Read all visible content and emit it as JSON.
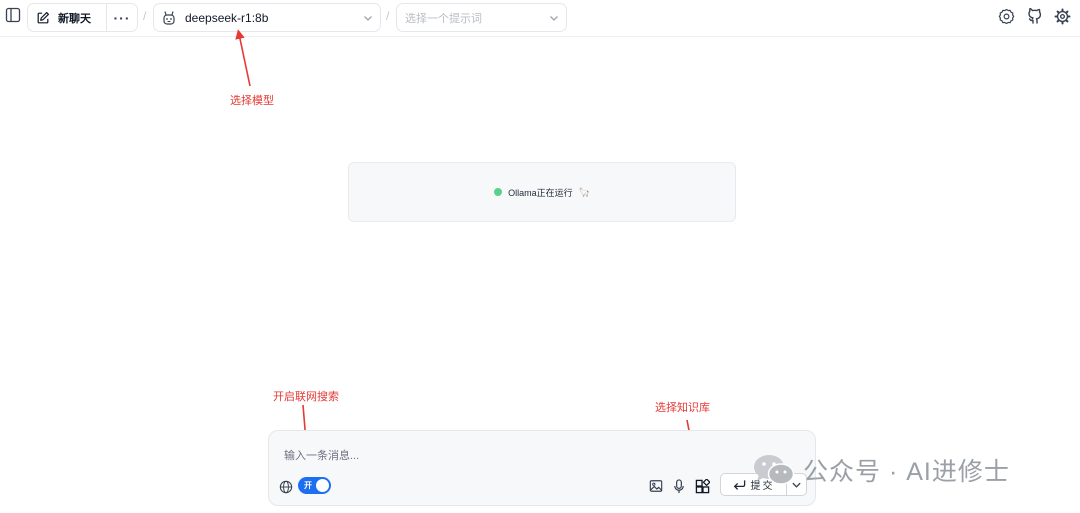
{
  "topbar": {
    "new_chat_label": "新聊天",
    "more_label": "···",
    "separator": "/",
    "model_value": "deepseek-r1:8b",
    "prompt_placeholder": "选择一个提示词"
  },
  "annotations": {
    "select_model": "选择模型",
    "web_search": "开启联网搜索",
    "knowledge_base": "选择知识库"
  },
  "status": {
    "text": "Ollama正在运行",
    "emoji": "🦙",
    "dot_color": "#5bd08a"
  },
  "composer": {
    "placeholder": "输入一条消息...",
    "toggle_label": "开",
    "toggle_on": true,
    "submit_label": "提交"
  },
  "watermark": {
    "text": "公众号 · AI进修士"
  },
  "colors": {
    "accent": "#1d6ff2",
    "annotation": "#e53935"
  },
  "icons": [
    "sidebar-toggle-icon",
    "edit-icon",
    "robot-icon",
    "chevron-down-icon",
    "settings-icon",
    "github-icon",
    "gear-icon",
    "globe-icon",
    "image-icon",
    "mic-icon",
    "knowledge-base-icon",
    "enter-icon",
    "wechat-icon"
  ]
}
